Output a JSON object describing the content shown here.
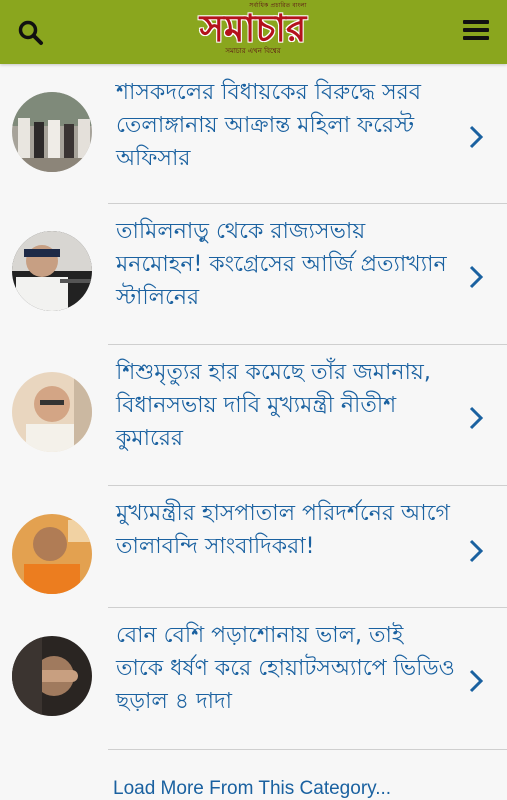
{
  "header": {
    "logo_top": "সর্বাধিক প্রচারিত বাংলা",
    "logo_text": "সমাচার",
    "logo_sub": "সমাচার এখন বিশ্বের",
    "search_icon": "search-icon",
    "menu_icon": "hamburger-menu-icon",
    "background": "#8aa61e"
  },
  "articles": [
    {
      "title": "শাসকদলের বিধায়কের বিরুদ্ধে সরব তেলাঙ্গানায় আক্রান্ত মহিলা ফরেস্ট অফিসার"
    },
    {
      "title": "তামিলনাড়ু থেকে রাজ্যসভায় মনমোহন! কংগ্রেসের আর্জি প্রত্যাখ্যান স্টালিনের"
    },
    {
      "title": "শিশুমৃত্যুর হার কমেছে তাঁর জমানায়, বিধানসভায় দাবি মুখ্যমন্ত্রী নীতীশ কুমারের"
    },
    {
      "title": "মুখ্যমন্ত্রীর হাসপাতাল পরিদর্শনের আগে তালাবন্দি সাংবাদিকরা!"
    },
    {
      "title": "বোন বেশি পড়াশোনায় ভাল, তাই তাকে ধর্ষণ করে হোয়াটসঅ্যাপে ভিডিও ছড়াল ৪ দাদা"
    }
  ],
  "load_more": "Load More From This Category...",
  "colors": {
    "link": "#1a61a0",
    "divider": "#cfcfcf"
  }
}
